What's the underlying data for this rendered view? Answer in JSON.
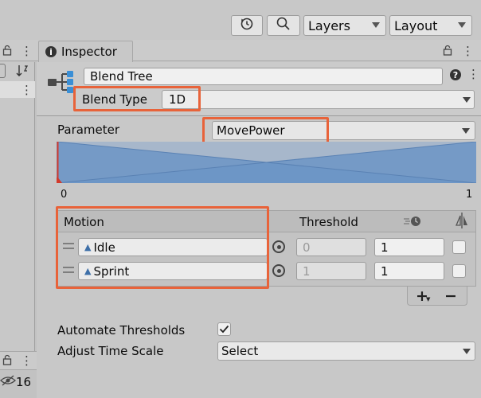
{
  "toolbar": {
    "layers_label": "Layers",
    "layout_label": "Layout"
  },
  "left_panel": {
    "count": "16"
  },
  "inspector": {
    "tab_label": "Inspector",
    "object_name": "Blend Tree",
    "blend_type_label": "Blend Type",
    "blend_type_value": "1D",
    "parameter_label": "Parameter",
    "parameter_value": "MovePower",
    "range_min": "0",
    "range_max": "1",
    "list": {
      "col_motion": "Motion",
      "col_threshold": "Threshold",
      "rows": [
        {
          "motion": "Idle",
          "threshold": "0",
          "time_scale": "1"
        },
        {
          "motion": "Sprint",
          "threshold": "1",
          "time_scale": "1"
        }
      ],
      "add_label": "+",
      "remove_label": "−"
    },
    "automate_thresholds_label": "Automate Thresholds",
    "automate_thresholds_checked": true,
    "adjust_time_scale_label": "Adjust Time Scale",
    "adjust_time_scale_value": "Select"
  },
  "colors": {
    "highlight": "#e8633a",
    "graph_blue": "#6c95c6",
    "marker_red": "#d33a2c"
  }
}
